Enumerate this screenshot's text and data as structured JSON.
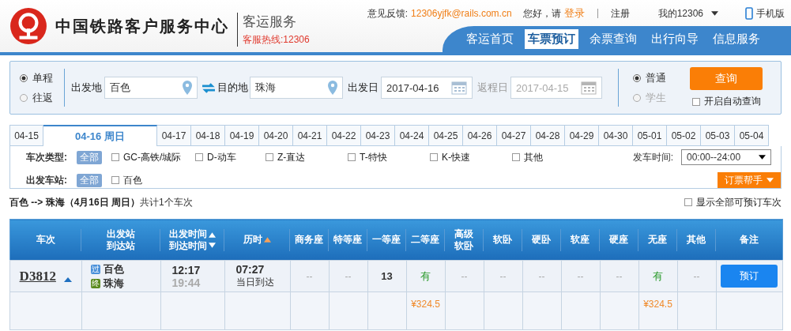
{
  "header": {
    "title": "中国铁路客户服务中心",
    "subtitle": "客运服务",
    "hotline": "客服热线:12306",
    "feedback_label": "意见反馈:",
    "feedback_email": "12306yjfk@rails.com.cn",
    "greeting": "您好，请",
    "login": "登录",
    "register": "注册",
    "account": "我的12306",
    "mobile": "手机版"
  },
  "nav": [
    {
      "label": "客运首页",
      "selected": false
    },
    {
      "label": "车票预订",
      "selected": true
    },
    {
      "label": "余票查询",
      "selected": false
    },
    {
      "label": "出行向导",
      "selected": false
    },
    {
      "label": "信息服务",
      "selected": false
    }
  ],
  "search": {
    "trip_types": [
      {
        "label": "单程",
        "selected": true
      },
      {
        "label": "往返",
        "selected": false
      }
    ],
    "from_label": "出发地",
    "from_value": "百色",
    "to_label": "目的地",
    "to_value": "珠海",
    "depart_label": "出发日",
    "depart_value": "2017-04-16",
    "return_label": "返程日",
    "return_value": "2017-04-15",
    "return_disabled": true,
    "passenger_types": [
      {
        "label": "普通",
        "selected": true,
        "disabled": false
      },
      {
        "label": "学生",
        "selected": false,
        "disabled": true
      }
    ],
    "query_button": "查询",
    "auto_query": {
      "label": "开启自动查询",
      "checked": false
    }
  },
  "dates": [
    {
      "label": "04-15",
      "selected": false
    },
    {
      "label": "04-16 周日",
      "selected": true
    },
    {
      "label": "04-17",
      "selected": false
    },
    {
      "label": "04-18",
      "selected": false
    },
    {
      "label": "04-19",
      "selected": false
    },
    {
      "label": "04-20",
      "selected": false
    },
    {
      "label": "04-21",
      "selected": false
    },
    {
      "label": "04-22",
      "selected": false
    },
    {
      "label": "04-23",
      "selected": false
    },
    {
      "label": "04-24",
      "selected": false
    },
    {
      "label": "04-25",
      "selected": false
    },
    {
      "label": "04-26",
      "selected": false
    },
    {
      "label": "04-27",
      "selected": false
    },
    {
      "label": "04-28",
      "selected": false
    },
    {
      "label": "04-29",
      "selected": false
    },
    {
      "label": "04-30",
      "selected": false
    },
    {
      "label": "05-01",
      "selected": false
    },
    {
      "label": "05-02",
      "selected": false
    },
    {
      "label": "05-03",
      "selected": false
    },
    {
      "label": "05-04",
      "selected": false
    }
  ],
  "filters": {
    "train_type_label": "车次类型:",
    "train_type_all": "全部",
    "train_types": [
      {
        "label": "GC-高铁/城际",
        "checked": false
      },
      {
        "label": "D-动车",
        "checked": false
      },
      {
        "label": "Z-直达",
        "checked": false
      },
      {
        "label": "T-特快",
        "checked": false
      },
      {
        "label": "K-快速",
        "checked": false
      },
      {
        "label": "其他",
        "checked": false
      }
    ],
    "station_label": "出发车站:",
    "station_all": "全部",
    "stations": [
      {
        "label": "百色",
        "checked": false
      }
    ],
    "time_label": "发车时间:",
    "time_value": "00:00--24:00",
    "helper": "订票帮手"
  },
  "summary": {
    "route": "百色 --> 珠海（4月16日  周日）",
    "count": "共计1个车次",
    "show_all": {
      "label": "显示全部可预订车次",
      "checked": false
    }
  },
  "table": {
    "columns": [
      {
        "lines": [
          "车次"
        ]
      },
      {
        "lines": [
          "出发站",
          "到达站"
        ]
      },
      {
        "lines": [
          "出发时间",
          "到达时间"
        ],
        "sort_up": true,
        "sort_down": true,
        "sort_active": false
      },
      {
        "lines": [
          "历时"
        ],
        "sort_up": true,
        "sort_active": true
      },
      {
        "lines": [
          "商务座"
        ]
      },
      {
        "lines": [
          "特等座"
        ]
      },
      {
        "lines": [
          "一等座"
        ]
      },
      {
        "lines": [
          "二等座"
        ]
      },
      {
        "lines": [
          "高级",
          "软卧"
        ]
      },
      {
        "lines": [
          "软卧"
        ]
      },
      {
        "lines": [
          "硬卧"
        ]
      },
      {
        "lines": [
          "软座"
        ]
      },
      {
        "lines": [
          "硬座"
        ]
      },
      {
        "lines": [
          "无座"
        ]
      },
      {
        "lines": [
          "其他"
        ]
      },
      {
        "lines": [
          "备注"
        ]
      }
    ],
    "rows": [
      {
        "train": "D3812",
        "from": {
          "badge": "过",
          "color": "#4a90d9",
          "name": "百色"
        },
        "to": {
          "badge": "终",
          "color": "#5a8a1e",
          "name": "珠海"
        },
        "depart": "12:17",
        "arrive": "19:44",
        "duration": "07:27",
        "arrival_day": "当日到达",
        "seats": [
          {
            "value": "--",
            "kind": "none"
          },
          {
            "value": "--",
            "kind": "none"
          },
          {
            "value": "13",
            "kind": "count"
          },
          {
            "value": "有",
            "kind": "available",
            "price": "¥324.5"
          },
          {
            "value": "--",
            "kind": "none"
          },
          {
            "value": "--",
            "kind": "none"
          },
          {
            "value": "--",
            "kind": "none"
          },
          {
            "value": "--",
            "kind": "none"
          },
          {
            "value": "--",
            "kind": "none"
          },
          {
            "value": "有",
            "kind": "available",
            "price": "¥324.5"
          },
          {
            "value": "--",
            "kind": "none"
          }
        ],
        "button": "预订"
      }
    ]
  }
}
